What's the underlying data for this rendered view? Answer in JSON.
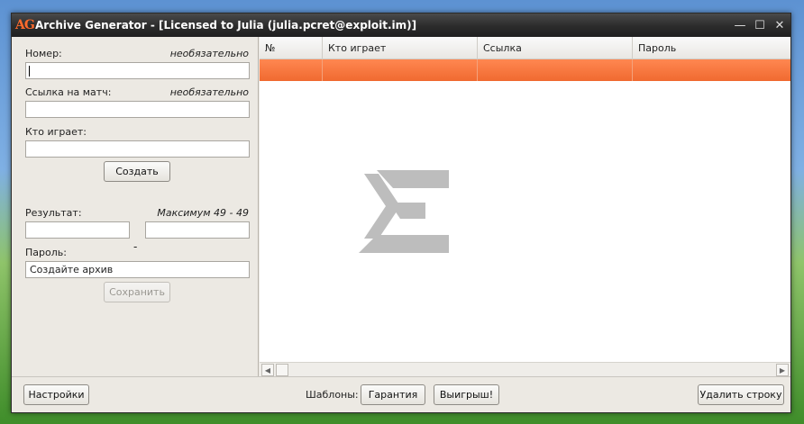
{
  "window": {
    "logo": "AG",
    "title": "Archive Generator - [Licensed to Julia (julia.pcret@exploit.im)]",
    "controls": {
      "minimize": "—",
      "maximize": "☐",
      "close": "✕"
    }
  },
  "form": {
    "number": {
      "label": "Номер:",
      "hint": "необязательно",
      "value": ""
    },
    "match_link": {
      "label": "Ссылка на матч:",
      "hint": "необязательно",
      "value": ""
    },
    "who_plays": {
      "label": "Кто играет:",
      "value": ""
    },
    "create_button": "Создать",
    "result": {
      "label": "Результат:",
      "hint": "Максимум 49 - 49",
      "left_value": "",
      "separator": "-",
      "right_value": ""
    },
    "password": {
      "label": "Пароль:",
      "value": "Создайте архив"
    },
    "save_button": "Сохранить"
  },
  "table": {
    "columns": [
      "№",
      "Кто играет",
      "Ссылка",
      "Пароль"
    ],
    "rows": [
      [
        "",
        "",
        "",
        ""
      ]
    ],
    "selected_color": "#f06a30"
  },
  "bottom": {
    "settings_button": "Настройки",
    "templates_label": "Шаблоны:",
    "guarantee_button": "Гарантия",
    "win_button": "Выигрыш!",
    "delete_row_button": "Удалить строку"
  },
  "colors": {
    "accent": "#ff6a2b",
    "titlebar": "#2b2b2b",
    "watermark": "#bdbdbd"
  }
}
